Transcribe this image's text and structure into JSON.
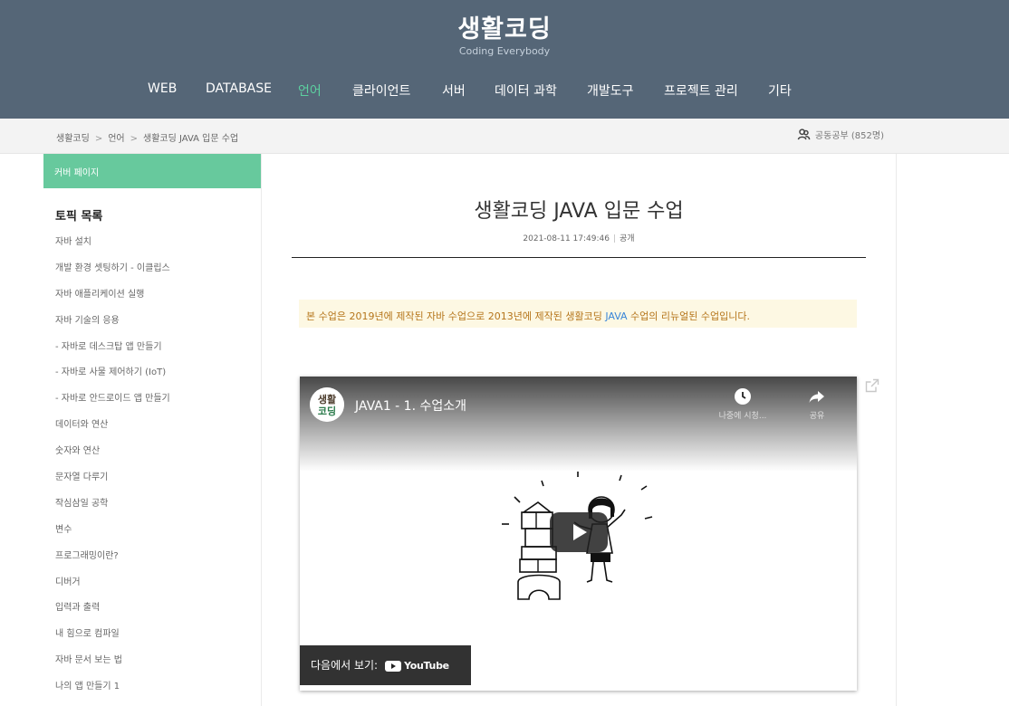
{
  "site": {
    "title": "생활코딩",
    "subtitle": "Coding Everybody"
  },
  "nav": [
    {
      "label": "WEB"
    },
    {
      "label": "DATABASE"
    },
    {
      "label": "언어"
    },
    {
      "label": "클라이언트"
    },
    {
      "label": "서버"
    },
    {
      "label": "데이터 과학"
    },
    {
      "label": "개발도구"
    },
    {
      "label": "프로젝트 관리"
    },
    {
      "label": "기타"
    }
  ],
  "nav_active_color": "#5cd1a0",
  "header_color": "#556677",
  "breadcrumb": {
    "items": [
      "생활코딩",
      "언어",
      "생활코딩 JAVA 입문 수업"
    ],
    "separator": ">"
  },
  "study": {
    "icon": "group-icon",
    "label": "공동공부 (852명)"
  },
  "sidebar": {
    "cover_label": "커버 페이지",
    "cover_color": "#67c99d",
    "topics_title": "토픽 목록",
    "topics": [
      "자바 설치",
      "개발 환경 셋팅하기 - 이클립스",
      "자바 애플리케이션 실행",
      "자바 기술의 응용",
      "- 자바로 데스크탑 앱 만들기",
      "- 자바로 사물 제어하기 (IoT)",
      "- 자바로 안드로이드 앱 만들기",
      "데이터와 연산",
      "숫자와 연산",
      "문자열 다루기",
      "작심삼일 공학",
      "변수",
      "프로그래밍이란?",
      "디버거",
      "입력과 출력",
      "내 힘으로 컴파일",
      "자바 문서 보는 법",
      "나의 앱 만들기 1"
    ]
  },
  "post": {
    "title": "생활코딩 JAVA 입문 수업",
    "date": "2021-08-11 17:49:46",
    "visibility": "공개",
    "notice_before": "본 수업은 2019년에 제작된 자바 수업으로 2013년에 제작된 생활코딩 ",
    "notice_link": "JAVA",
    "notice_after": " 수업의 리뉴얼된 수업입니다."
  },
  "video": {
    "title": "JAVA1 - 1. 수업소개",
    "watch_later": "나중에 시청...",
    "share": "공유",
    "watch_on": "다음에서 보기:",
    "youtube": "YouTube",
    "channel_logo_text": [
      "생활",
      "코딩"
    ]
  }
}
